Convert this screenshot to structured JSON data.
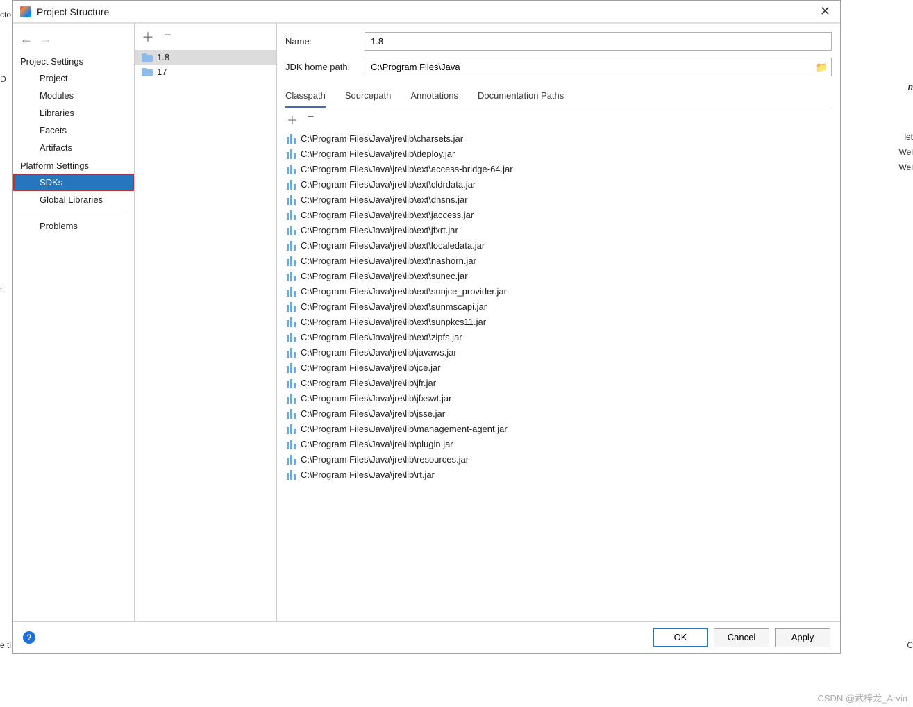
{
  "window": {
    "title": "Project Structure"
  },
  "sidebar": {
    "sections": [
      {
        "header": "Project Settings",
        "items": [
          "Project",
          "Modules",
          "Libraries",
          "Facets",
          "Artifacts"
        ]
      },
      {
        "header": "Platform Settings",
        "items": [
          "SDKs",
          "Global Libraries"
        ]
      }
    ],
    "problems": "Problems",
    "selected": "SDKs"
  },
  "sdk_list": {
    "items": [
      {
        "name": "1.8"
      },
      {
        "name": "17"
      }
    ],
    "selected_index": 0
  },
  "detail": {
    "name_label": "Name:",
    "name_value": "1.8",
    "jdk_path_label": "JDK home path:",
    "jdk_path_value": "C:\\Program Files\\Java",
    "tabs": [
      "Classpath",
      "Sourcepath",
      "Annotations",
      "Documentation Paths"
    ],
    "active_tab": 0,
    "classpath": [
      "C:\\Program Files\\Java\\jre\\lib\\charsets.jar",
      "C:\\Program Files\\Java\\jre\\lib\\deploy.jar",
      "C:\\Program Files\\Java\\jre\\lib\\ext\\access-bridge-64.jar",
      "C:\\Program Files\\Java\\jre\\lib\\ext\\cldrdata.jar",
      "C:\\Program Files\\Java\\jre\\lib\\ext\\dnsns.jar",
      "C:\\Program Files\\Java\\jre\\lib\\ext\\jaccess.jar",
      "C:\\Program Files\\Java\\jre\\lib\\ext\\jfxrt.jar",
      "C:\\Program Files\\Java\\jre\\lib\\ext\\localedata.jar",
      "C:\\Program Files\\Java\\jre\\lib\\ext\\nashorn.jar",
      "C:\\Program Files\\Java\\jre\\lib\\ext\\sunec.jar",
      "C:\\Program Files\\Java\\jre\\lib\\ext\\sunjce_provider.jar",
      "C:\\Program Files\\Java\\jre\\lib\\ext\\sunmscapi.jar",
      "C:\\Program Files\\Java\\jre\\lib\\ext\\sunpkcs11.jar",
      "C:\\Program Files\\Java\\jre\\lib\\ext\\zipfs.jar",
      "C:\\Program Files\\Java\\jre\\lib\\javaws.jar",
      "C:\\Program Files\\Java\\jre\\lib\\jce.jar",
      "C:\\Program Files\\Java\\jre\\lib\\jfr.jar",
      "C:\\Program Files\\Java\\jre\\lib\\jfxswt.jar",
      "C:\\Program Files\\Java\\jre\\lib\\jsse.jar",
      "C:\\Program Files\\Java\\jre\\lib\\management-agent.jar",
      "C:\\Program Files\\Java\\jre\\lib\\plugin.jar",
      "C:\\Program Files\\Java\\jre\\lib\\resources.jar",
      "C:\\Program Files\\Java\\jre\\lib\\rt.jar"
    ]
  },
  "footer": {
    "ok": "OK",
    "cancel": "Cancel",
    "apply": "Apply"
  },
  "background": {
    "left_frag_1": "cto",
    "left_frag_2": "D",
    "left_frag_3": "t",
    "left_frag_4": "e tl",
    "right_frag_1": "let",
    "right_frag_2": "Wel",
    "right_frag_3": "Wel",
    "right_frag_4": "n",
    "right_frag_5": "C"
  },
  "watermark": "CSDN @武梓龙_Arvin"
}
